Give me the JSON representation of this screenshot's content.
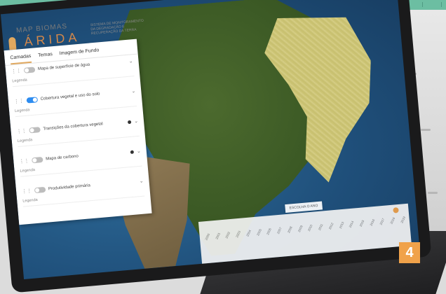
{
  "logo": {
    "brand": "MAP BIOMAS",
    "word": "ÁRIDA",
    "description": "SISTEMA DE MONITORAMENTO DA DEGRADAÇÃO E RECUPERAÇÃO DA TERRA"
  },
  "tabs": [
    "Camadas",
    "Temas",
    "Imagem de Fundo"
  ],
  "active_tab_index": 0,
  "layers": [
    {
      "label": "Mapa de superfície de água",
      "on": false,
      "info": false,
      "legend": "Legenda"
    },
    {
      "label": "Cobertura vegetal e uso do solo",
      "on": true,
      "info": false,
      "legend": "Legenda"
    },
    {
      "label": "Transições da cobertura vegetal",
      "on": false,
      "info": true,
      "legend": "Legenda"
    },
    {
      "label": "Mapa de carbono",
      "on": false,
      "info": true,
      "legend": "Legenda"
    },
    {
      "label": "Produtividade primária",
      "on": false,
      "info": false,
      "legend": "Legenda"
    }
  ],
  "year_selector": {
    "title": "ESCOLHA O ANO",
    "years": [
      "2000",
      "2001",
      "2002",
      "2003",
      "2004",
      "2005",
      "2006",
      "2007",
      "2008",
      "2009",
      "2010",
      "2011",
      "2012",
      "2013",
      "2014",
      "2015",
      "2016",
      "2017",
      "2018",
      "2019"
    ],
    "selected": "2019"
  },
  "badge": "4",
  "colors": {
    "accent": "#f0a24a",
    "toggle_on": "#2d8cf0",
    "arid_region": "#cfc779",
    "topbar": "#6cbea2"
  }
}
